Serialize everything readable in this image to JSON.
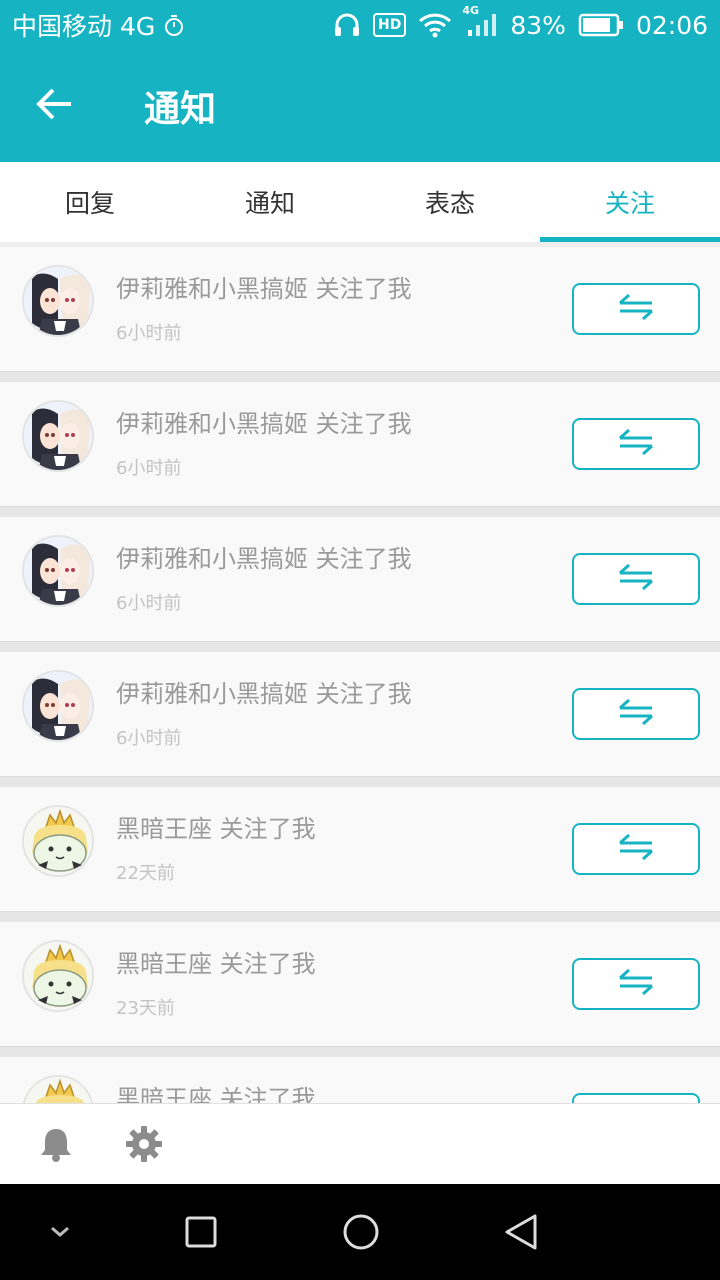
{
  "status_bar": {
    "carrier": "中国移动 4G",
    "network_badge": "4G",
    "hd_badge": "HD",
    "battery": "83%",
    "time": "02:06",
    "icons": [
      "stopwatch-icon",
      "headphones-icon",
      "wifi-icon",
      "signal-icon",
      "battery-icon"
    ]
  },
  "app_bar": {
    "title": "通知",
    "back_icon": "arrow-left-icon"
  },
  "tabs": [
    {
      "label": "回复",
      "active": false
    },
    {
      "label": "通知",
      "active": false
    },
    {
      "label": "表态",
      "active": false
    },
    {
      "label": "关注",
      "active": true
    }
  ],
  "notifications": [
    {
      "user": "伊莉雅和小黑搞姬",
      "text": "伊莉雅和小黑搞姬 关注了我",
      "time": "6小时前",
      "avatar": "anime-duo-avatar"
    },
    {
      "user": "伊莉雅和小黑搞姬",
      "text": "伊莉雅和小黑搞姬 关注了我",
      "time": "6小时前",
      "avatar": "anime-duo-avatar"
    },
    {
      "user": "伊莉雅和小黑搞姬",
      "text": "伊莉雅和小黑搞姬 关注了我",
      "time": "6小时前",
      "avatar": "anime-duo-avatar"
    },
    {
      "user": "伊莉雅和小黑搞姬",
      "text": "伊莉雅和小黑搞姬 关注了我",
      "time": "6小时前",
      "avatar": "anime-duo-avatar"
    },
    {
      "user": "黑暗王座",
      "text": "黑暗王座 关注了我",
      "time": "22天前",
      "avatar": "crowned-blob-avatar"
    },
    {
      "user": "黑暗王座",
      "text": "黑暗王座 关注了我",
      "time": "23天前",
      "avatar": "crowned-blob-avatar"
    },
    {
      "user": "黑暗王座",
      "text": "黑暗王座 关注了我",
      "time": "",
      "avatar": "crowned-blob-avatar"
    }
  ],
  "follow_button_icon": "mutual-follow-arrows-icon",
  "bottom_bar": {
    "icons": [
      "bell-icon",
      "gear-icon"
    ]
  },
  "nav_bar": {
    "icons": [
      "chevron-down-icon",
      "square-icon",
      "circle-icon",
      "triangle-back-icon"
    ]
  },
  "colors": {
    "accent": "#16b4c2",
    "item_text": "#9a9a9a",
    "time_text": "#c4c4c4"
  }
}
